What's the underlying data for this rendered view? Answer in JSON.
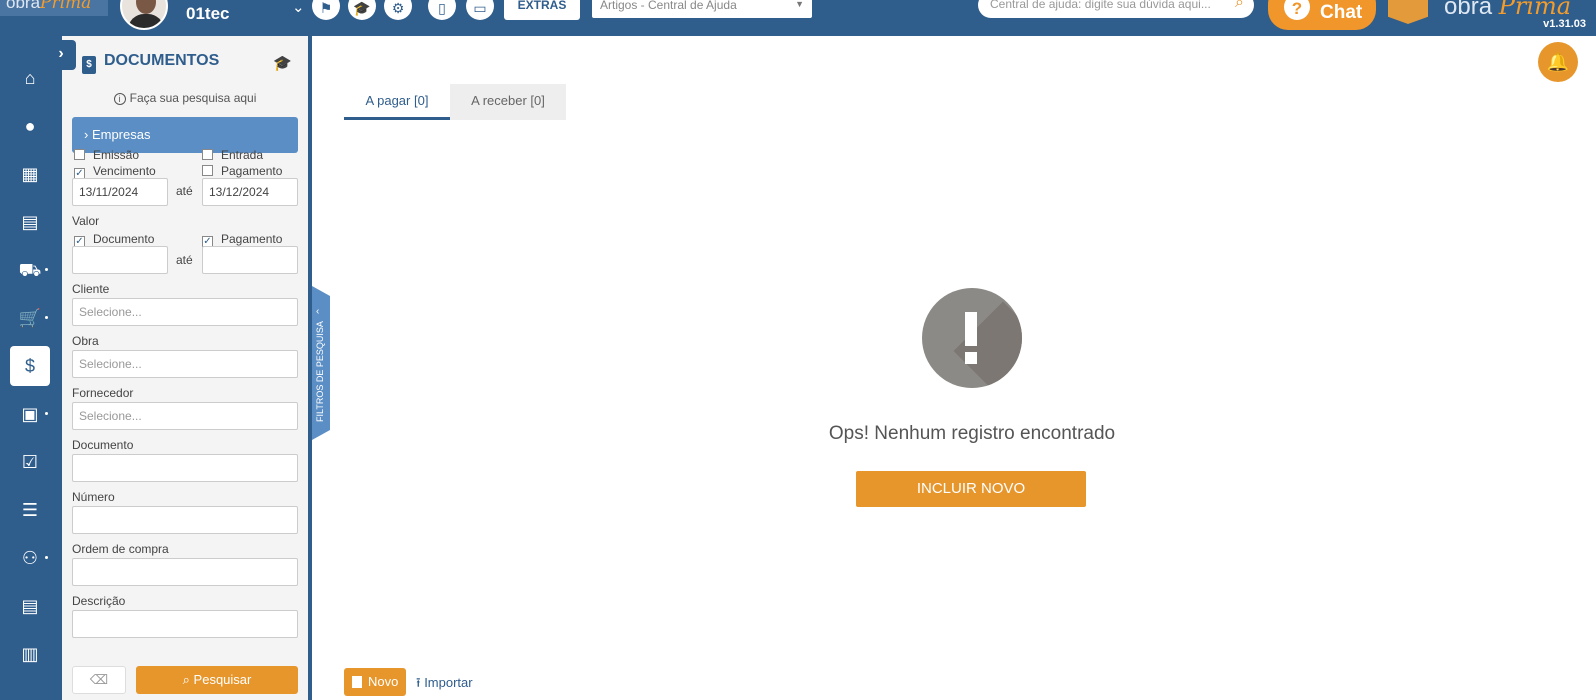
{
  "header": {
    "logo_left": "obra",
    "logo_left_script": "Prima",
    "company": "01tec",
    "extras_label": "EXTRAS",
    "articles_select": "Artigos - Central de Ajuda",
    "help_search_placeholder": "Central de ajuda: digite sua dúvida aqui...",
    "chat_label": "Chat",
    "logo_right": "obra",
    "logo_right_script": "Prima",
    "version": "v1.31.03"
  },
  "colors": {
    "primary": "#2f5d8c",
    "accent": "#e7962c",
    "panel": "#f4f4f4",
    "accordion": "#5b8ec4"
  },
  "nav": [
    "home-icon",
    "user-icon",
    "building-icon",
    "document-dollar-icon",
    "truck-icon",
    "cart-icon",
    "dollar-icon",
    "archive-icon",
    "checklist-doc-icon",
    "list-check-icon",
    "team-icon",
    "report-icon",
    "chart-icon"
  ],
  "filter": {
    "title": "DOCUMENTOS",
    "hint": "Faça sua pesquisa aqui",
    "accordion": "Empresas",
    "chk_emissao": "Emissão",
    "chk_entrada": "Entrada",
    "chk_vencimento": "Vencimento",
    "chk_pagamento": "Pagamento",
    "date_from": "13/11/2024",
    "date_to": "13/12/2024",
    "ate": "até",
    "valor_label": "Valor",
    "chk_val_documento": "Documento",
    "chk_val_pagamento": "Pagamento",
    "cliente_label": "Cliente",
    "obra_label": "Obra",
    "fornecedor_label": "Fornecedor",
    "select_placeholder": "Selecione...",
    "documento_label": "Documento",
    "numero_label": "Número",
    "ordem_label": "Ordem de compra",
    "descricao_label": "Descrição",
    "search_label": "Pesquisar",
    "side_tab": "FILTROS DE PESQUISA"
  },
  "main": {
    "tab_pagar": "A pagar [0]",
    "tab_receber": "A receber [0]",
    "empty_message": "Ops! Nenhum registro encontrado",
    "include_label": "INCLUIR NOVO",
    "novo_label": "Novo",
    "import_label": "Importar"
  }
}
